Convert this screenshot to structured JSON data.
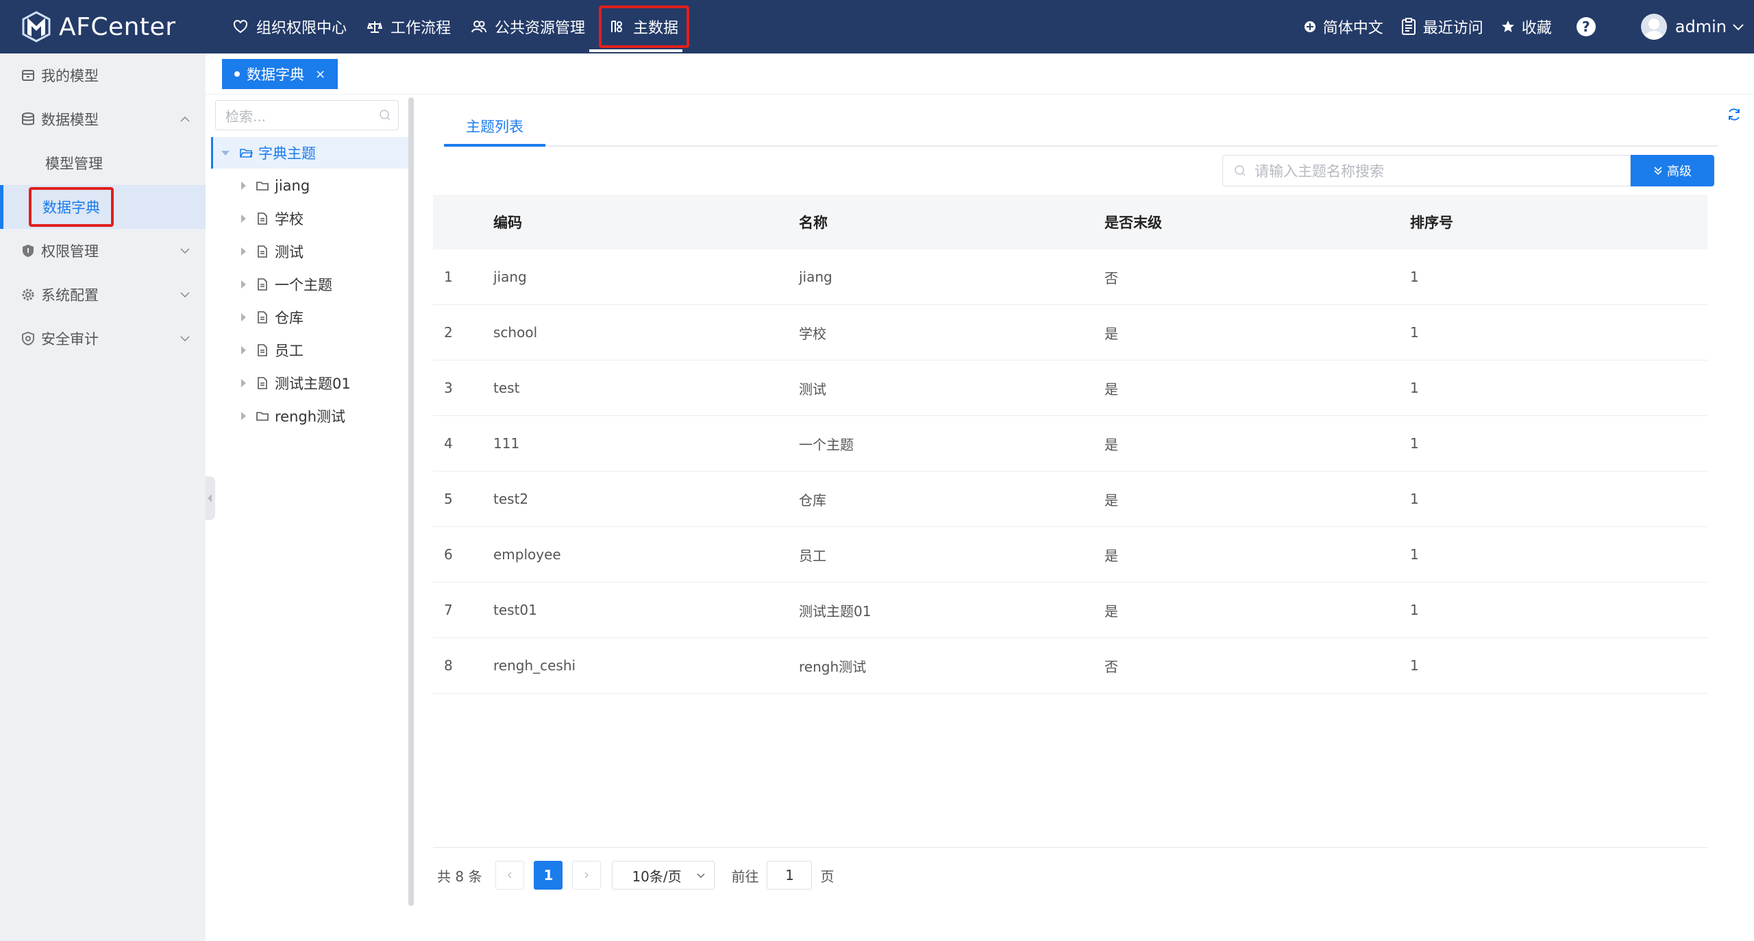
{
  "header": {
    "brand": "AFCenter",
    "nav": [
      {
        "label": "组织权限中心",
        "icon": "heart-shield-icon"
      },
      {
        "label": "工作流程",
        "icon": "scale-icon"
      },
      {
        "label": "公共资源管理",
        "icon": "users-icon"
      },
      {
        "label": "主数据",
        "icon": "master-data-icon",
        "active": true
      }
    ],
    "language": "简体中文",
    "recent": "最近访问",
    "favorites": "收藏",
    "help": "?",
    "user": "admin"
  },
  "sidebar": {
    "items": [
      {
        "label": "我的模型",
        "icon": "model-box-icon"
      },
      {
        "label": "数据模型",
        "icon": "database-icon",
        "expanded": true
      },
      {
        "label": "模型管理"
      },
      {
        "label": "数据字典",
        "active": true
      },
      {
        "label": "权限管理",
        "icon": "shield-icon"
      },
      {
        "label": "系统配置",
        "icon": "gear-icon"
      },
      {
        "label": "安全审计",
        "icon": "audit-shield-icon"
      }
    ]
  },
  "tagbar": {
    "tag_label": "数据字典",
    "close": "×"
  },
  "tree": {
    "search_placeholder": "检索...",
    "root": "字典主题",
    "nodes": [
      {
        "label": "jiang",
        "icon": "folder-icon"
      },
      {
        "label": "学校",
        "icon": "file-icon"
      },
      {
        "label": "测试",
        "icon": "file-icon"
      },
      {
        "label": "一个主题",
        "icon": "file-icon"
      },
      {
        "label": "仓库",
        "icon": "file-icon"
      },
      {
        "label": "员工",
        "icon": "file-icon"
      },
      {
        "label": "测试主题01",
        "icon": "file-icon"
      },
      {
        "label": "rengh测试",
        "icon": "folder-icon"
      }
    ]
  },
  "main": {
    "tab": "主题列表",
    "search_placeholder": "请输入主题名称搜索",
    "advanced": "高级",
    "columns": [
      "编码",
      "名称",
      "是否末级",
      "排序号"
    ],
    "rows": [
      {
        "idx": "1",
        "code": "jiang",
        "name": "jiang",
        "leaf": "否",
        "order": "1"
      },
      {
        "idx": "2",
        "code": "school",
        "name": "学校",
        "leaf": "是",
        "order": "1"
      },
      {
        "idx": "3",
        "code": "test",
        "name": "测试",
        "leaf": "是",
        "order": "1"
      },
      {
        "idx": "4",
        "code": "111",
        "name": "一个主题",
        "leaf": "是",
        "order": "1"
      },
      {
        "idx": "5",
        "code": "test2",
        "name": "仓库",
        "leaf": "是",
        "order": "1"
      },
      {
        "idx": "6",
        "code": "employee",
        "name": "员工",
        "leaf": "是",
        "order": "1"
      },
      {
        "idx": "7",
        "code": "test01",
        "name": "测试主题01",
        "leaf": "是",
        "order": "1"
      },
      {
        "idx": "8",
        "code": "rengh_ceshi",
        "name": "rengh测试",
        "leaf": "否",
        "order": "1"
      }
    ],
    "pager": {
      "total": "共 8 条",
      "current": "1",
      "page_size": "10条/页",
      "goto_prefix": "前往",
      "goto_value": "1",
      "goto_suffix": "页"
    }
  },
  "colors": {
    "topbar": "#243b68",
    "accent": "#1b7cec",
    "highlight": "#e0201c"
  }
}
